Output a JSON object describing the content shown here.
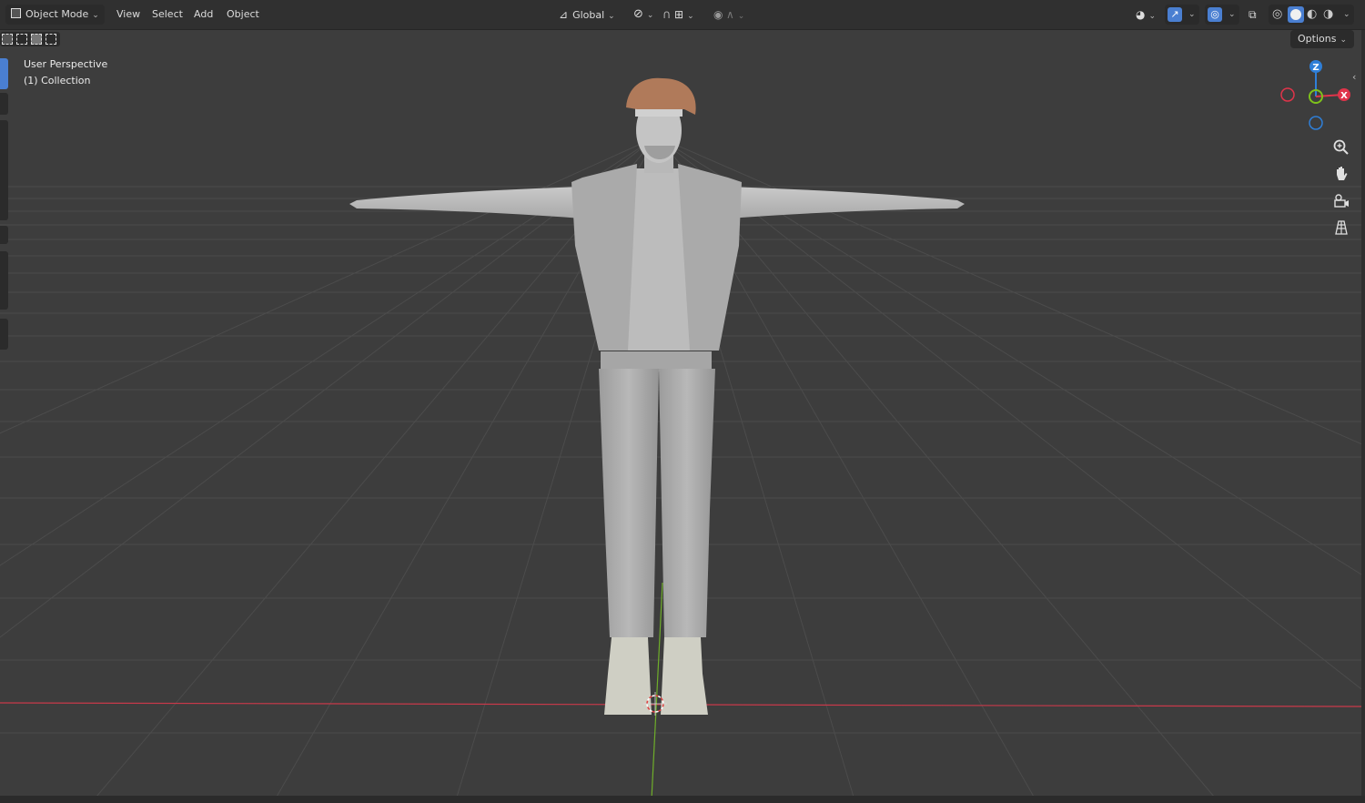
{
  "header": {
    "mode": "Object Mode",
    "menus": [
      "View",
      "Select",
      "Add",
      "Object"
    ],
    "orientation": "Global"
  },
  "options_label": "Options",
  "viewport": {
    "view_name": "User Perspective",
    "collection": "(1) Collection"
  },
  "gizmo": {
    "axis_z": "Z",
    "axis_x": "X",
    "colors": {
      "x": "#e0344a",
      "y": "#7ec21b",
      "z": "#2f7fd8"
    }
  },
  "icons": {
    "mode_icon": "object-mode-icon",
    "transform_orientation": "orientation-icon",
    "pivot": "pivot-icon",
    "snap": "magnet-icon",
    "snap_increment": "snap-increment-icon",
    "proportional": "proportional-edit-icon",
    "falloff": "falloff-curve-icon",
    "visibility": "eye-icon",
    "gizmos": "gizmo-icon",
    "overlays": "overlays-icon",
    "xray": "xray-icon",
    "shading": [
      "wireframe-icon",
      "solid-icon",
      "material-icon",
      "rendered-icon"
    ],
    "nav": [
      "zoom-icon",
      "hand-pan-icon",
      "camera-icon",
      "grid-ortho-icon"
    ]
  },
  "colors": {
    "background": "#3d3d3d",
    "header": "#303030",
    "x_axis_line": "#c8394a",
    "y_axis_line": "#6fae2a",
    "active_blue": "#4a7fd1"
  }
}
